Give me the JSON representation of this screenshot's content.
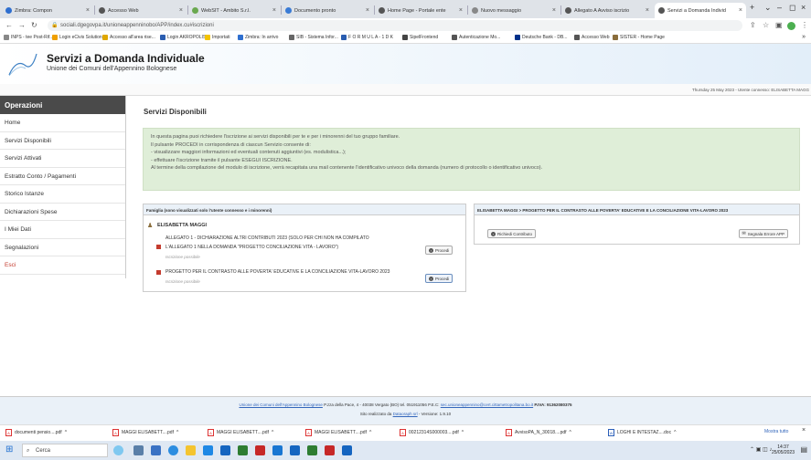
{
  "browser": {
    "tabs": [
      {
        "label": "Zimbra: Compon",
        "color": "#2f6fcf"
      },
      {
        "label": "Accesso Web",
        "color": "#555555"
      },
      {
        "label": "WebSIT - Ambito S.r.l.",
        "color": "#6aa84f"
      },
      {
        "label": "Documento pronto",
        "color": "#3a7bd5"
      },
      {
        "label": "Home Page - Portale ente",
        "color": "#555555"
      },
      {
        "label": "Nuovo messaggio",
        "color": "#888888"
      },
      {
        "label": "Allegato A Avviso iscrizio",
        "color": "#555555"
      },
      {
        "label": "Servizi a Domanda Individ",
        "color": "#555555"
      }
    ],
    "url": "sociali.dgegovpa.it/unioneappenninobo/APP/index.cu#iscrizioni",
    "bookmarks": [
      "INPS - tee Post-Rif...",
      "Login eCivis Solution",
      "Accesso all'area rise...",
      "Login AKROPOLIS",
      "Importati",
      "Zimbra: In arrivo",
      "SIB - Sistema Infor...",
      "F O R M U L A - 1 D K",
      "SipelFrontend",
      "Autenticazione Mo...",
      "Deutsche Bank - DB...",
      "Accesso Web",
      "SISTER - Home Page"
    ]
  },
  "header": {
    "title": "Servizi a Domanda Individuale",
    "subtitle": "Unione dei Comuni dell'Appennino Bolognese",
    "userinfo": "Thursday 25 May 2023 - Utente connesso: ELISABETTA MAGG"
  },
  "sidebar": {
    "heading": "Operazioni",
    "items": [
      "Home",
      "Servizi Disponibili",
      "Servizi Attivati",
      "Estratto Conto / Pagamenti",
      "Storico Istanze",
      "Dichiarazioni Spese",
      "I Miei Dati",
      "Segnalazioni",
      "Esci"
    ]
  },
  "main": {
    "title": "Servizi Disponibili",
    "info": [
      "In questa pagina puoi richiedere l'iscrizione ai servizi disponibili per te e per i minorenni del tuo gruppo familiare.",
      "Il pulsante PROCEDI in corrispondenza di ciascun Servizio consente di:",
      "- visualizzare maggiori informazioni ed eventuali contenuti aggiuntivi (es. modulistica...);",
      "- effettuare l'iscrizione tramite il pulsante ESEGUI ISCRIZIONE.",
      "Al termine della compilazione del modulo di iscrizione, verrà recapitata una mail contenente l'identificativo univoco della domanda (numero di protocollo o identificativo univoco)."
    ],
    "famiglia": {
      "header": "Famiglia (sono visualizzati solo l'utente connesso e i minorenni)",
      "person": "ELISABETTA MAGGI",
      "services": [
        {
          "title1": "ALLEGATO 1 - DICHIARAZIONE ALTRI CONTRIBUTI 2023 (SOLO PER CHI NON HA COMPILATO",
          "title2": "L'ALLEGATO 1 NELLA DOMANDA \"PROGETTO CONCILIAZIONE VITA - LAVORO\")",
          "status": "Iscrizione possibile",
          "button": "Procedi"
        },
        {
          "title1": "PROGETTO PER IL CONTRASTO ALLE POVERTA' EDUCATIVE E LA CONCILIAZIONE VITA-LAVORO 2023",
          "status": "Iscrizione possibile",
          "button": "Procedi"
        }
      ]
    },
    "dettaglio": {
      "header": "ELISABETTA MAGGI > PROGETTO PER IL CONTRASTO ALLE POVERTA' EDUCATIVE E LA CONCILIAZIONE VITA-LAVORO 2023",
      "richiedi": "Richiedi Contributo",
      "segnala": "Segnala Errore APP"
    }
  },
  "footer": {
    "link": "Unione dei Comuni dell'Appennino Bolognese",
    "address": " P.zza della Pace, 4 - 40038 Vergato (BO) tel. 051911056 P.E.C: ",
    "pec": "sec.unioneappennino@cert.cittametropolitana.bo.it",
    "piva": " P.IVA: 91362080375",
    "credit_pre": "Sito realizzato da ",
    "credit_link": "Dataoraph srl",
    "credit_post": " - Versione: 1.9.10"
  },
  "downloads": {
    "items": [
      "documenti pensio....pdf",
      "MAGGI ELISABETT....pdf",
      "MAGGI ELISABETT....pdf",
      "MAGGI ELISABETT....pdf",
      "00212314S000003....pdf",
      "AvvisoPA_N_30018....pdf",
      "LOGHI E INTESTAZ....doc"
    ],
    "show_all": "Mostra tutto"
  },
  "taskbar": {
    "search": "Cerca",
    "time": "14:37",
    "date": "25/05/2023"
  }
}
